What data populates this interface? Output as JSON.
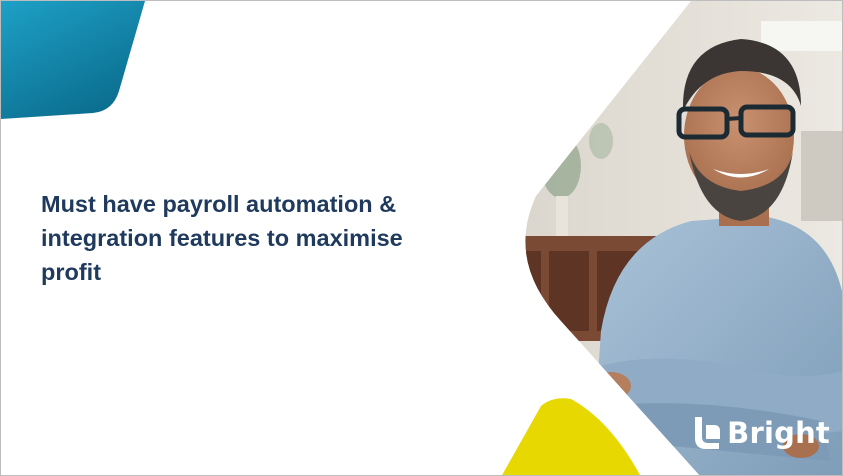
{
  "slide": {
    "title_lines": [
      "Must have payroll automation &",
      "integration features to maximise",
      "profit"
    ],
    "logo_text": "Bright",
    "logo_icon": "bright-b-mark",
    "photo_subject": "smiling-man-glasses-arms-crossed",
    "colors": {
      "title": "#1f3a5c",
      "teal_top": "#1ea0c6",
      "teal_bottom": "#0b6e8f",
      "yellow": "#e6d800",
      "logo": "#ffffff"
    }
  }
}
